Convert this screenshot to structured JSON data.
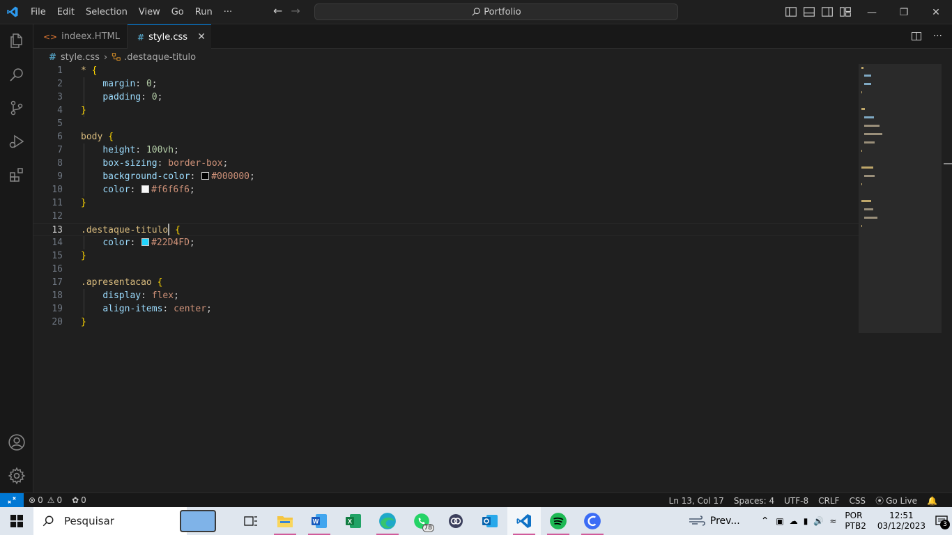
{
  "titlebar": {
    "menu": [
      "File",
      "Edit",
      "Selection",
      "View",
      "Go",
      "Run",
      "···"
    ],
    "search_text": "Portfolio"
  },
  "tabs": [
    {
      "label": "indeex.HTML",
      "icon": "html-icon"
    },
    {
      "label": "style.css",
      "icon": "css-icon",
      "active": true
    }
  ],
  "breadcrumb": {
    "file": "style.css",
    "symbol": ".destaque-titulo"
  },
  "editor": {
    "active_line": 13,
    "line_numbers": [
      "1",
      "2",
      "3",
      "4",
      "5",
      "6",
      "7",
      "8",
      "9",
      "10",
      "11",
      "12",
      "13",
      "14",
      "15",
      "16",
      "17",
      "18",
      "19",
      "20"
    ],
    "tokens": {
      "star": "*",
      "open": "{",
      "close": "}",
      "colon": ":",
      "semi": ";",
      "margin": "margin",
      "padding": "padding",
      "zero": "0",
      "body": "body",
      "height": "height",
      "height_val": "100vh",
      "box_sizing": "box-sizing",
      "box_sizing_val": "border-box",
      "bg_color": "background-color",
      "bg_color_val": "#000000",
      "color": "color",
      "color_val_body": "#f6f6f6",
      "sel_destaque": ".destaque-titulo",
      "color_val_destaque": "#22D4FD",
      "sel_apresentacao": ".apresentacao",
      "display": "display",
      "display_val": "flex",
      "align_items": "align-items",
      "align_items_val": "center"
    },
    "swatches": {
      "black": "#000000",
      "white": "#f6f6f6",
      "cyan": "#22D4FD"
    }
  },
  "statusbar": {
    "errors": "0",
    "warnings": "0",
    "ports": "0",
    "position": "Ln 13, Col 17",
    "spaces": "Spaces: 4",
    "encoding": "UTF-8",
    "eol": "CRLF",
    "language": "CSS",
    "golive": "Go Live"
  },
  "taskbar": {
    "search_placeholder": "Pesquisar",
    "whatsapp_badge": "78",
    "weather_text": "Prev...",
    "lang1": "POR",
    "lang2": "PTB2",
    "time": "12:51",
    "date": "03/12/2023",
    "notif_count": "3"
  },
  "colors": {
    "accent": "#0078d4",
    "selector": "#d7ba7d",
    "property": "#9cdcfe",
    "value": "#ce9178",
    "number": "#b5cea8",
    "brace": "#ffd700"
  }
}
